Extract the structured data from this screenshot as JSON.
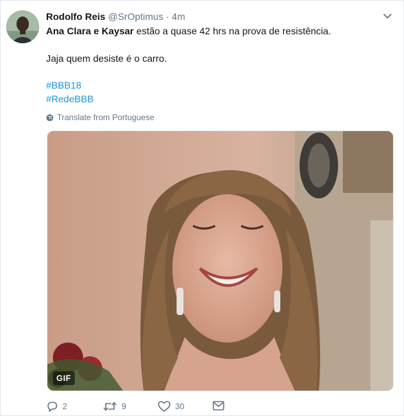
{
  "tweet": {
    "author_name": "Rodolfo Reis",
    "author_handle": "@SrOptimus",
    "separator": "·",
    "time": "4m",
    "line1_bold": "Ana Clara e Kaysar",
    "line1_rest": " estão a quase 42 hrs na prova de resistência.",
    "line2": "Jaja quem desiste é o carro.",
    "hashtags": [
      "#BBB18",
      "#RedeBBB"
    ],
    "translate_label": "Translate from Portuguese",
    "media_badge": "GIF"
  },
  "actions": {
    "reply_count": "2",
    "retweet_count": "9",
    "like_count": "30"
  },
  "icons": {
    "menu": "chevron-down-icon",
    "translate": "globe-icon",
    "reply": "reply-icon",
    "retweet": "retweet-icon",
    "like": "heart-icon",
    "dm": "envelope-icon"
  },
  "colors": {
    "link": "#1b95e0",
    "meta": "#657786",
    "text": "#14171a"
  }
}
